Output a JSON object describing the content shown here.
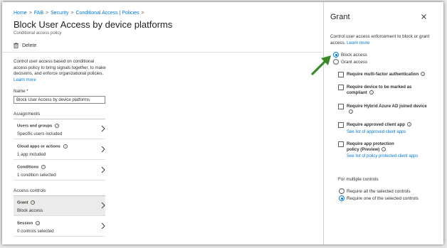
{
  "breadcrumb": [
    "Home",
    "FAB",
    "Security",
    "Conditional Access | Policies"
  ],
  "page": {
    "title": "Block User Access by device platforms",
    "subtitle": "Conditional access policy"
  },
  "toolbar": {
    "delete_label": "Delete"
  },
  "description": {
    "text": "Control user access based on conditional access policy to bring signals together, to make decisions, and enforce organizational policies.",
    "link": "Learn more"
  },
  "name_field": {
    "label": "Name *",
    "value": "Block User Access by device platforms"
  },
  "assignments": {
    "heading": "Assignments",
    "items": [
      {
        "title": "Users and groups",
        "value": "Specific users included"
      },
      {
        "title": "Cloud apps or actions",
        "value": "1 app included"
      },
      {
        "title": "Conditions",
        "value": "1 condition selected"
      }
    ]
  },
  "access_controls": {
    "heading": "Access controls",
    "items": [
      {
        "title": "Grant",
        "value": "Block access"
      },
      {
        "title": "Session",
        "value": "0 controls selected"
      }
    ]
  },
  "grant_panel": {
    "title": "Grant",
    "description": "Control user access enforcement to block or grant access.",
    "learn_more": "Learn more",
    "options": [
      {
        "label": "Block access",
        "selected": true
      },
      {
        "label": "Grant access",
        "selected": false
      }
    ],
    "requirements": [
      {
        "label": "Require multi-factor authentication",
        "link": ""
      },
      {
        "label": "Require device to be marked as compliant",
        "link": ""
      },
      {
        "label": "Require Hybrid Azure AD joined device",
        "link": ""
      },
      {
        "label": "Require approved client app",
        "link": "See list of approved client apps"
      },
      {
        "label": "Require app protection policy (Preview)",
        "link": "See list of policy protected client apps"
      }
    ],
    "multiple_controls": {
      "heading": "For multiple controls",
      "options": [
        {
          "label": "Require all the selected controls",
          "selected": false
        },
        {
          "label": "Require one of the selected controls",
          "selected": true
        }
      ]
    }
  },
  "colors": {
    "accent": "#0078d4",
    "arrow": "#3a8a2a"
  },
  "icons": [
    "chevron-right-icon",
    "trash-icon",
    "info-icon",
    "close-icon",
    "arrow-icon"
  ]
}
